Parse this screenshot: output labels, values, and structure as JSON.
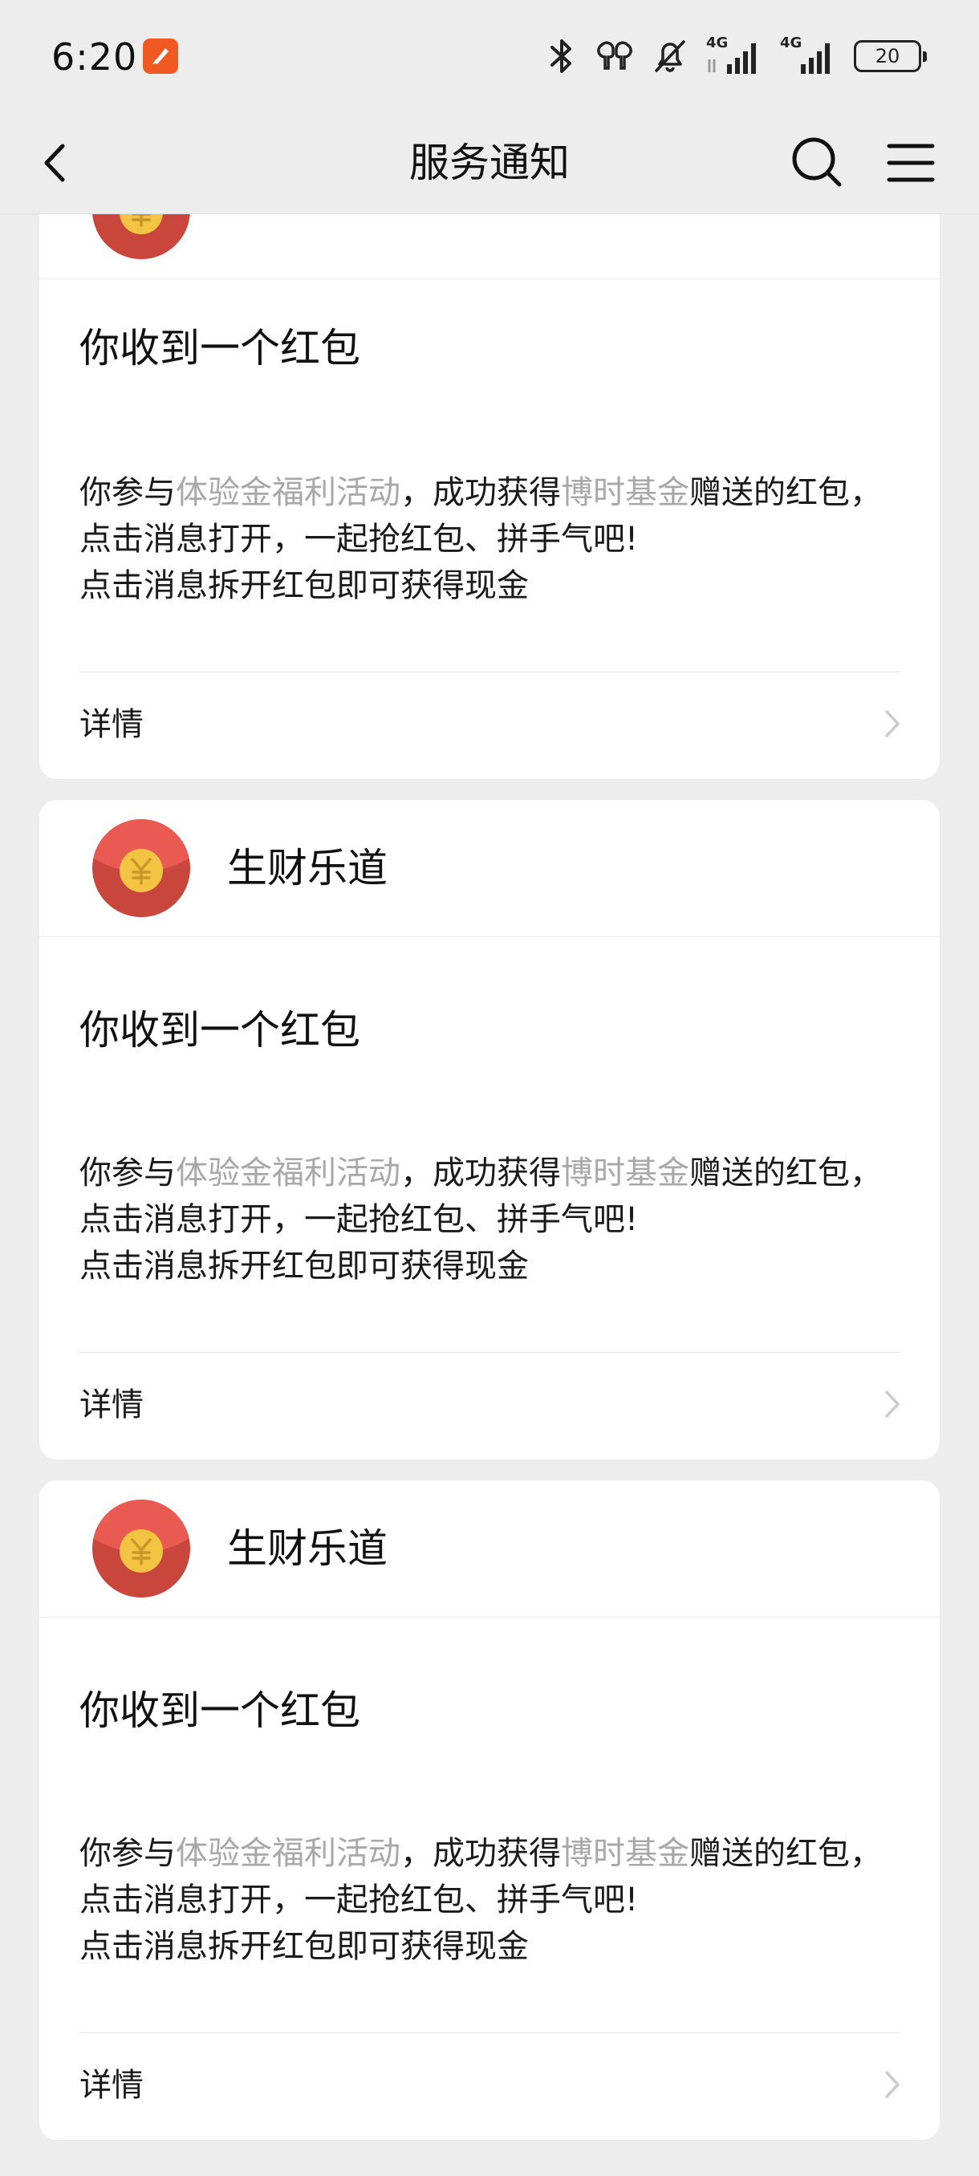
{
  "status_bar": {
    "time": "6:20",
    "network_1": "4G",
    "network_2": "4G",
    "battery": "20"
  },
  "header": {
    "title": "服务通知"
  },
  "cards": [
    {
      "sender": "",
      "title": "你收到一个红包",
      "body": {
        "p1": "你参与",
        "h1": "体验金福利活动",
        "p2": "，成功获得",
        "h2": "博时基金",
        "p3": "赠送的红包，点击消息打开，一起抢红包、拼手气吧!",
        "line2": "点击消息拆开红包即可获得现金"
      },
      "details": "详情"
    },
    {
      "sender": "生财乐道",
      "title": "你收到一个红包",
      "body": {
        "p1": "你参与",
        "h1": "体验金福利活动",
        "p2": "，成功获得",
        "h2": "博时基金",
        "p3": "赠送的红包，点击消息打开，一起抢红包、拼手气吧!",
        "line2": "点击消息拆开红包即可获得现金"
      },
      "details": "详情"
    },
    {
      "sender": "生财乐道",
      "title": "你收到一个红包",
      "body": {
        "p1": "你参与",
        "h1": "体验金福利活动",
        "p2": "，成功获得",
        "h2": "博时基金",
        "p3": "赠送的红包，点击消息打开，一起抢红包、拼手气吧!",
        "line2": "点击消息拆开红包即可获得现金"
      },
      "details": "详情"
    }
  ],
  "icons": {
    "avatar": "red-envelope-avatar-icon",
    "back": "back-arrow-icon",
    "search": "search-icon",
    "menu": "menu-icon",
    "chevron": "chevron-right-icon"
  },
  "colors": {
    "highlight_text": "#a8a8a8",
    "envelope_red": "#d9453b",
    "coin_gold": "#f3c443",
    "app_badge": "#f05a22"
  }
}
